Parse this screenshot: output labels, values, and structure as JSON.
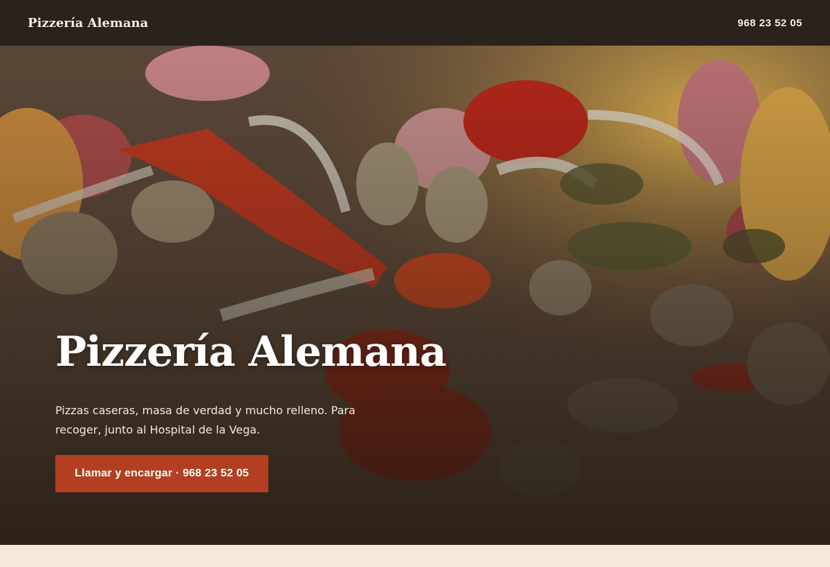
{
  "header": {
    "brand": "Pizzería Alemana",
    "phone": "968 23 52 05"
  },
  "hero": {
    "background_image": "pizza-closeup-photo",
    "title": "Pizzería Alemana",
    "subtitle": "Pizzas caseras, masa de verdad y mucho relleno. Para recoger, junto al Hospital de la Vega.",
    "cta_label": "Llamar y encargar · 968 23 52 05"
  },
  "colors": {
    "header_bg": "#2a221c",
    "cta_bg": "#b23f22",
    "page_bg": "#f3ead9"
  }
}
